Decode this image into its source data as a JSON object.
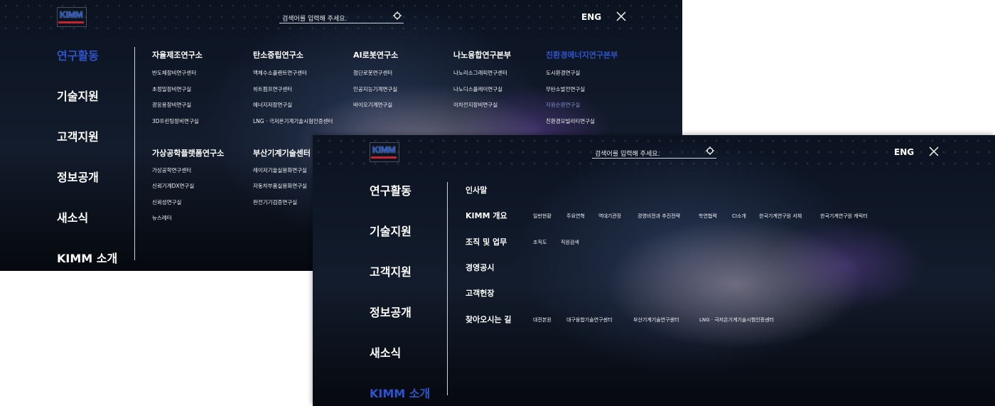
{
  "search_placeholder": "검색어를 입력해 주세요.",
  "lang_label": "ENG",
  "logo_text": "KIMM",
  "main_nav": [
    "연구활동",
    "기술지원",
    "고객지원",
    "정보공개",
    "새소식",
    "KIMM 소개"
  ],
  "panel1": {
    "columns": [
      {
        "title": "자율제조연구소",
        "items": [
          "반도체장비연구센터",
          "초정밀장비연구실",
          "광응용장비연구실",
          "3D프린팅장비연구실"
        ]
      },
      {
        "title": "탄소중립연구소",
        "items": [
          "액체수소플랜트연구센터",
          "히트펌프연구센터",
          "에너지저장연구실",
          "LNG · 극저온기계기술시험인증센터"
        ]
      },
      {
        "title": "AI로봇연구소",
        "items": [
          "첨단로봇연구센터",
          "인공지능기계연구실",
          "바이오기계연구실"
        ]
      },
      {
        "title": "나노융합연구본부",
        "items": [
          "나노리소그래피연구센터",
          "나노디스플레이연구실",
          "이차전지장비연구실"
        ]
      },
      {
        "title": "친환경에너지연구본부",
        "items": [
          "도시환경연구실",
          "무탄소발전연구실",
          "자원순환연구실",
          "친환경모빌리티연구실"
        ]
      },
      {
        "title": "가상공학플랫폼연구소",
        "items": [
          "가상공학연구센터",
          "신뢰기계DX연구실",
          "신뢰성연구실",
          "뉴스레터"
        ]
      },
      {
        "title": "부산기계기술센터",
        "items": [
          "레이저기술실용화연구실",
          "자동차부품실용화연구실",
          "완전기기검증연구실"
        ]
      }
    ]
  },
  "panel2": {
    "items": [
      {
        "title": "인사말",
        "subs": []
      },
      {
        "title": "KIMM 개요",
        "subs": [
          "일반현황",
          "주요연혁",
          "역대기관장",
          "경영비전과 추진전략",
          "학연협력",
          "CI소개",
          "한국기계연구원 서체",
          "한국기계연구원 캐릭터"
        ]
      },
      {
        "title": "조직 및 업무",
        "subs": [
          "조직도",
          "직원검색"
        ]
      },
      {
        "title": "경영공시",
        "subs": []
      },
      {
        "title": "고객헌장",
        "subs": []
      },
      {
        "title": "찾아오시는 길",
        "subs": [
          "대전본원",
          "대구융합기술연구센터",
          "부산기계기술연구센터",
          "LNG · 극저온기계기술시험인증센터"
        ]
      }
    ]
  },
  "colors": {
    "accent": "#2f54c8",
    "logo_red": "#c3262c",
    "panel_bg": "#0b1321"
  }
}
